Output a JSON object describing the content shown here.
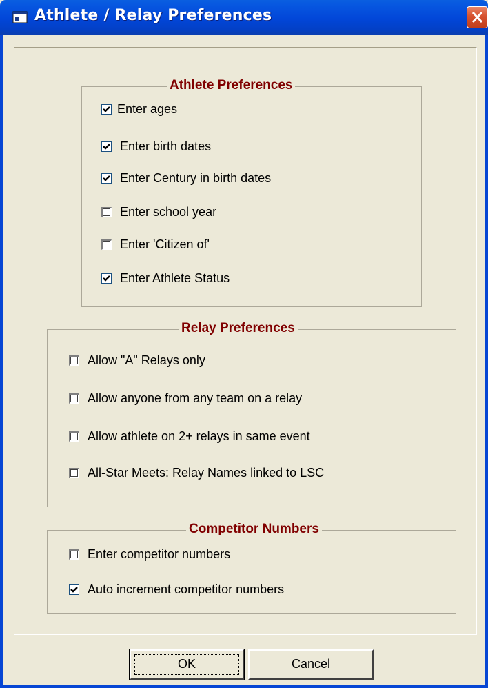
{
  "window": {
    "title": "Athlete / Relay Preferences",
    "icon": "app-window-icon",
    "close_icon": "close-icon"
  },
  "groups": {
    "athlete": {
      "title": "Athlete Preferences",
      "items": [
        {
          "label": "Enter ages",
          "checked": true
        },
        {
          "label": "Enter birth dates",
          "checked": true
        },
        {
          "label": "Enter Century in birth dates",
          "checked": true
        },
        {
          "label": "Enter school year",
          "checked": false
        },
        {
          "label": "Enter 'Citizen of'",
          "checked": false
        },
        {
          "label": "Enter Athlete Status",
          "checked": true
        }
      ]
    },
    "relay": {
      "title": "Relay Preferences",
      "items": [
        {
          "label": "Allow \"A\" Relays only",
          "checked": false
        },
        {
          "label": "Allow anyone from any team on a relay",
          "checked": false
        },
        {
          "label": "Allow athlete on 2+ relays in same event",
          "checked": false
        },
        {
          "label": "All-Star Meets: Relay Names linked to LSC",
          "checked": false
        }
      ]
    },
    "competitor": {
      "title": "Competitor Numbers",
      "items": [
        {
          "label": "Enter competitor numbers",
          "checked": false
        },
        {
          "label": "Auto increment competitor numbers",
          "checked": true
        }
      ]
    }
  },
  "buttons": {
    "ok_label": "OK",
    "cancel_label": "Cancel"
  },
  "colors": {
    "titlebar": "#0246d8",
    "dialog_bg": "#ece9d8",
    "group_title": "#800000"
  }
}
